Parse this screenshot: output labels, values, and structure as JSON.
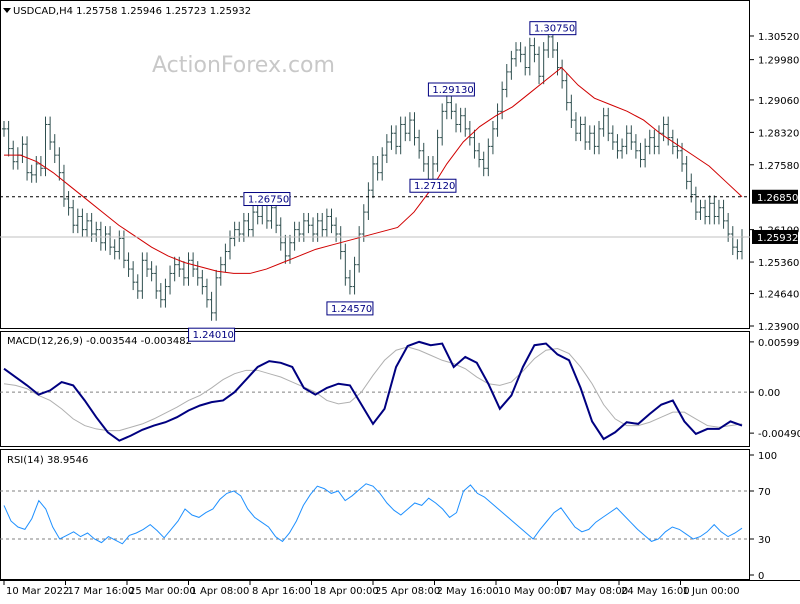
{
  "colors": {
    "background": "#ffffff",
    "price_bars": "#2f4f4f",
    "ma": "#d00000",
    "macd_line": "#000080",
    "macd_signal": "#b0b0b0",
    "rsi": "#1e90ff",
    "grid": "#808080",
    "label_box": "#000080"
  },
  "header": {
    "price": "USDCAD,H4  1.25758  1.25946  1.25723  1.25932",
    "macd": "MACD(12,26,9) -0.003544 -0.003482",
    "rsi": "RSI(14) 38.9546"
  },
  "watermark": "ActionForex.com",
  "chart_data": [
    {
      "type": "line",
      "title": "USDCAD,H4",
      "yticks": [
        "1.30520",
        "1.29980",
        "1.29060",
        "1.28320",
        "1.27580",
        "1.26100",
        "1.25360",
        "1.24640",
        "1.23900"
      ],
      "ylim": [
        1.239,
        1.3125
      ],
      "series": [
        {
          "values": [
            1.284,
            1.2795,
            1.2765,
            1.278,
            1.2805,
            1.274,
            1.2735,
            1.276,
            1.275,
            1.285,
            1.281,
            1.278,
            1.274,
            1.268,
            1.266,
            1.262,
            1.264,
            1.261,
            1.263,
            1.26,
            1.261,
            1.258,
            1.26,
            1.257,
            1.256,
            1.259,
            1.254,
            1.252,
            1.249,
            1.247,
            1.254,
            1.252,
            1.251,
            1.247,
            1.245,
            1.248,
            1.251,
            1.253,
            1.252,
            1.25,
            1.254,
            1.252,
            1.25,
            1.248,
            1.245,
            1.242,
            1.25,
            1.253,
            1.256,
            1.259,
            1.261,
            1.26,
            1.263,
            1.261,
            1.265,
            1.264,
            1.267,
            1.263,
            1.266,
            1.262,
            1.258,
            1.255,
            1.258,
            1.261,
            1.26,
            1.263,
            1.262,
            1.26,
            1.263,
            1.261,
            1.264,
            1.262,
            1.26,
            1.256,
            1.25,
            1.248,
            1.253,
            1.26,
            1.265,
            1.27,
            1.276,
            1.274,
            1.278,
            1.281,
            1.283,
            1.28,
            1.285,
            1.283,
            1.286,
            1.282,
            1.279,
            1.276,
            1.272,
            1.276,
            1.282,
            1.288,
            1.29,
            1.288,
            1.285,
            1.287,
            1.284,
            1.282,
            1.279,
            1.277,
            1.275,
            1.28,
            1.284,
            1.288,
            1.293,
            1.297,
            1.3,
            1.302,
            1.301,
            1.298,
            1.303,
            1.301,
            1.296,
            1.302,
            1.305,
            1.302,
            1.298,
            1.295,
            1.29,
            1.286,
            1.283,
            1.285,
            1.281,
            1.283,
            1.28,
            1.284,
            1.287,
            1.283,
            1.281,
            1.279,
            1.28,
            1.283,
            1.281,
            1.279,
            1.277,
            1.28,
            1.282,
            1.28,
            1.283,
            1.285,
            1.282,
            1.28,
            1.279,
            1.276,
            1.272,
            1.269,
            1.265,
            1.266,
            1.264,
            1.267,
            1.264,
            1.266,
            1.263,
            1.26,
            1.257,
            1.256,
            1.2593
          ],
          "labels": [
            "10 Mar 2022",
            "17 Mar 16:00",
            "25 Mar 00:00",
            "1 Apr 08:00",
            "8 Apr 16:00",
            "18 Apr 00:00",
            "25 Apr 08:00",
            "2 May 16:00",
            "10 May 00:00",
            "17 May 08:00",
            "24 May 16:00",
            "1 Jun 00:00"
          ]
        },
        {
          "values": [
            1.278,
            1.278,
            1.2765,
            1.274,
            1.271,
            1.268,
            1.265,
            1.262,
            1.2595,
            1.257,
            1.255,
            1.2535,
            1.2525,
            1.2515,
            1.251,
            1.251,
            1.252,
            1.2535,
            1.255,
            1.2565,
            1.2575,
            1.2585,
            1.2595,
            1.2605,
            1.2615,
            1.265,
            1.27,
            1.276,
            1.281,
            1.2845,
            1.287,
            1.289,
            1.292,
            1.295,
            1.298,
            1.294,
            1.291,
            1.2895,
            1.288,
            1.286,
            1.283,
            1.2805,
            1.278,
            1.2755,
            1.272,
            1.2685
          ]
        }
      ],
      "annotations": [
        "1.26750",
        "1.24010",
        "1.24570",
        "1.29130",
        "1.27120",
        "1.30750"
      ],
      "markers": [
        {
          "value": 1.2685,
          "label": "1.26850"
        },
        {
          "value": 1.25932,
          "label": "1.25932"
        }
      ]
    },
    {
      "type": "line",
      "title": "MACD(12,26,9)",
      "yticks": [
        "0.005996",
        "0.00",
        "-0.004901"
      ],
      "ylim": [
        -0.0062,
        0.0067
      ],
      "series": [
        {
          "values": [
            0.0028,
            0.0018,
            0.0008,
            -0.0003,
            0.0002,
            0.0012,
            0.0008,
            -0.001,
            -0.003,
            -0.0048,
            -0.0058,
            -0.0052,
            -0.0045,
            -0.004,
            -0.0036,
            -0.003,
            -0.0022,
            -0.0016,
            -0.0012,
            -0.001,
            0.0,
            0.0015,
            0.003,
            0.0037,
            0.0035,
            0.003,
            0.0005,
            -0.0003,
            0.0005,
            0.001,
            0.0008,
            -0.0015,
            -0.0038,
            -0.002,
            0.003,
            0.0055,
            0.006,
            0.0056,
            0.0058,
            0.003,
            0.0042,
            0.0035,
            0.001,
            -0.002,
            -0.0004,
            0.003,
            0.0056,
            0.0058,
            0.0045,
            0.0038,
            0.0005,
            -0.0035,
            -0.0056,
            -0.0048,
            -0.0036,
            -0.0038,
            -0.0026,
            -0.0015,
            -0.001,
            -0.0035,
            -0.005,
            -0.0044,
            -0.0044,
            -0.0035,
            -0.004
          ]
        },
        {
          "values": [
            0.001,
            0.0008,
            0.0004,
            -0.0004,
            -0.001,
            -0.002,
            -0.0032,
            -0.004,
            -0.0044,
            -0.0046,
            -0.0046,
            -0.0042,
            -0.0038,
            -0.0032,
            -0.0025,
            -0.0018,
            -0.001,
            -0.0004,
            0.0005,
            0.0015,
            0.0022,
            0.0026,
            0.0026,
            0.0022,
            0.0018,
            0.0012,
            0.0006,
            0.0,
            -0.001,
            -0.0014,
            -0.0012,
            0.0,
            0.002,
            0.0038,
            0.005,
            0.0054,
            0.005,
            0.0044,
            0.0038,
            0.0034,
            0.0028,
            0.0018,
            0.001,
            0.0008,
            0.0012,
            0.0025,
            0.004,
            0.005,
            0.0052,
            0.0046,
            0.003,
            0.001,
            -0.0015,
            -0.0032,
            -0.004,
            -0.004,
            -0.0036,
            -0.003,
            -0.0024,
            -0.0024,
            -0.0032,
            -0.004,
            -0.0042,
            -0.004,
            -0.0038
          ]
        }
      ]
    },
    {
      "type": "line",
      "title": "RSI(14)",
      "yticks": [
        "100",
        "70",
        "30",
        "0"
      ],
      "ylim": [
        0,
        100
      ],
      "series": [
        {
          "values": [
            58,
            45,
            40,
            38,
            47,
            62,
            55,
            40,
            30,
            33,
            36,
            32,
            35,
            30,
            27,
            32,
            29,
            26,
            33,
            35,
            38,
            42,
            37,
            31,
            38,
            45,
            55,
            50,
            48,
            52,
            55,
            63,
            68,
            70,
            66,
            55,
            48,
            44,
            40,
            32,
            28,
            35,
            45,
            58,
            67,
            74,
            72,
            68,
            70,
            62,
            66,
            71,
            76,
            74,
            68,
            60,
            54,
            50,
            55,
            60,
            58,
            64,
            60,
            55,
            48,
            52,
            70,
            75,
            68,
            65,
            60,
            55,
            50,
            45,
            40,
            35,
            30,
            38,
            45,
            52,
            56,
            48,
            40,
            36,
            38,
            44,
            48,
            52,
            56,
            50,
            44,
            38,
            33,
            28,
            30,
            36,
            40,
            38,
            34,
            30,
            32,
            36,
            42,
            36,
            32,
            35,
            39
          ]
        }
      ]
    }
  ]
}
